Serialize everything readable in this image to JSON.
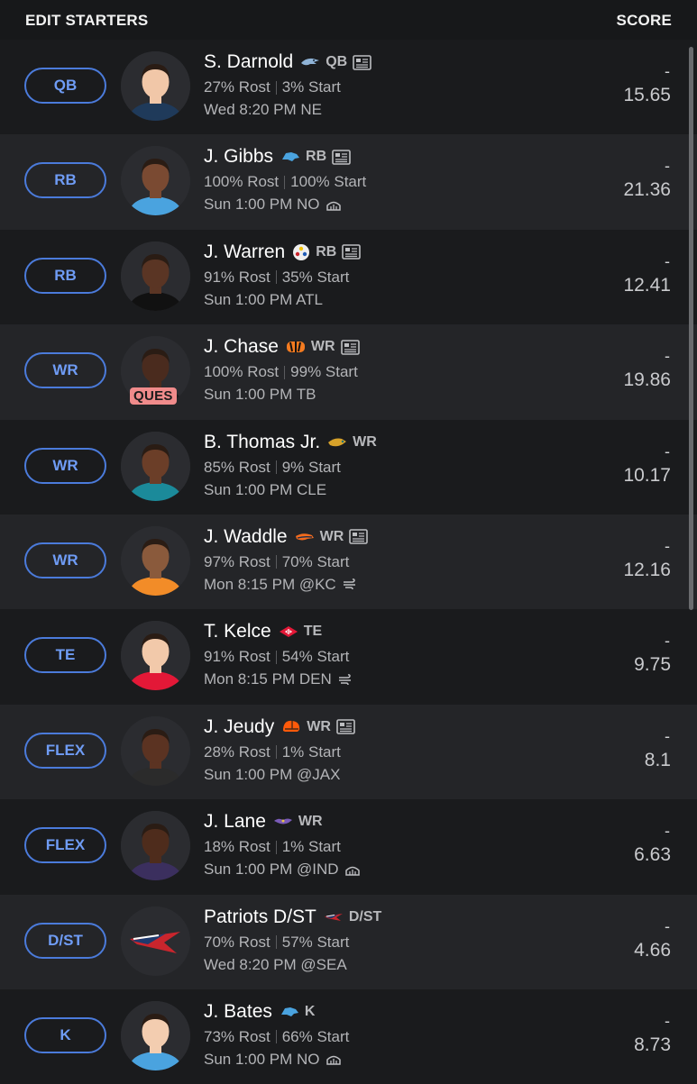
{
  "header": {
    "title": "EDIT STARTERS",
    "score_label": "SCORE"
  },
  "colors": {
    "accent": "#4b7bdb",
    "background": "#1d1e20",
    "ques_badge": "#f08b8b"
  },
  "players": [
    {
      "slot": "QB",
      "name": "S. Darnold",
      "team_icon": "seahawks-logo-icon",
      "position": "QB",
      "news": true,
      "rost": "27% Rost",
      "start": "3% Start",
      "game": "Wed 8:20 PM NE",
      "weather": "",
      "status": "",
      "score_dash": "-",
      "score": "15.65"
    },
    {
      "slot": "RB",
      "name": "J. Gibbs",
      "team_icon": "lions-logo-icon",
      "position": "RB",
      "news": true,
      "rost": "100% Rost",
      "start": "100% Start",
      "game": "Sun 1:00 PM NO",
      "weather": "dome-icon",
      "status": "",
      "score_dash": "-",
      "score": "21.36"
    },
    {
      "slot": "RB",
      "name": "J. Warren",
      "team_icon": "steelers-logo-icon",
      "position": "RB",
      "news": true,
      "rost": "91% Rost",
      "start": "35% Start",
      "game": "Sun 1:00 PM ATL",
      "weather": "",
      "status": "",
      "score_dash": "-",
      "score": "12.41"
    },
    {
      "slot": "WR",
      "name": "J. Chase",
      "team_icon": "bengals-logo-icon",
      "position": "WR",
      "news": true,
      "rost": "100% Rost",
      "start": "99% Start",
      "game": "Sun 1:00 PM TB",
      "weather": "",
      "status": "QUES",
      "score_dash": "-",
      "score": "19.86"
    },
    {
      "slot": "WR",
      "name": "B. Thomas Jr.",
      "team_icon": "jaguars-logo-icon",
      "position": "WR",
      "news": false,
      "rost": "85% Rost",
      "start": "9% Start",
      "game": "Sun 1:00 PM CLE",
      "weather": "",
      "status": "",
      "score_dash": "-",
      "score": "10.17"
    },
    {
      "slot": "WR",
      "name": "J. Waddle",
      "team_icon": "broncos-logo-icon",
      "position": "WR",
      "news": true,
      "rost": "97% Rost",
      "start": "70% Start",
      "game": "Mon 8:15 PM @KC",
      "weather": "wind-icon",
      "status": "",
      "score_dash": "-",
      "score": "12.16"
    },
    {
      "slot": "TE",
      "name": "T. Kelce",
      "team_icon": "chiefs-logo-icon",
      "position": "TE",
      "news": false,
      "rost": "91% Rost",
      "start": "54% Start",
      "game": "Mon 8:15 PM DEN",
      "weather": "wind-icon",
      "status": "",
      "score_dash": "-",
      "score": "9.75"
    },
    {
      "slot": "FLEX",
      "name": "J. Jeudy",
      "team_icon": "browns-logo-icon",
      "position": "WR",
      "news": true,
      "rost": "28% Rost",
      "start": "1% Start",
      "game": "Sun 1:00 PM @JAX",
      "weather": "",
      "status": "",
      "score_dash": "-",
      "score": "8.1"
    },
    {
      "slot": "FLEX",
      "name": "J. Lane",
      "team_icon": "ravens-logo-icon",
      "position": "WR",
      "news": false,
      "rost": "18% Rost",
      "start": "1% Start",
      "game": "Sun 1:00 PM @IND",
      "weather": "dome-icon",
      "status": "",
      "score_dash": "-",
      "score": "6.63"
    },
    {
      "slot": "D/ST",
      "name": "Patriots D/ST",
      "team_icon": "patriots-logo-icon",
      "position": "D/ST",
      "news": false,
      "rost": "70% Rost",
      "start": "57% Start",
      "game": "Wed 8:20 PM @SEA",
      "weather": "",
      "status": "",
      "score_dash": "-",
      "score": "4.66"
    },
    {
      "slot": "K",
      "name": "J. Bates",
      "team_icon": "lions-logo-icon",
      "position": "K",
      "news": false,
      "rost": "73% Rost",
      "start": "66% Start",
      "game": "Sun 1:00 PM NO",
      "weather": "dome-icon",
      "status": "",
      "score_dash": "-",
      "score": "8.73"
    }
  ]
}
